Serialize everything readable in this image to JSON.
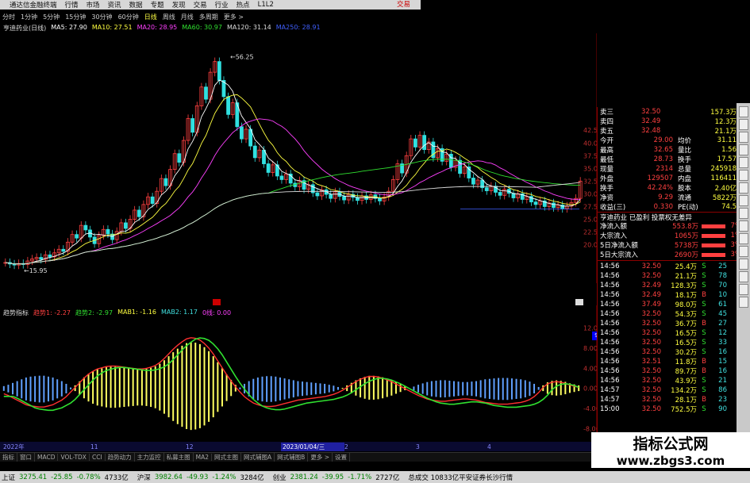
{
  "window": {
    "title": "通达信金融终端",
    "right_label": "交易"
  },
  "menu": [
    "行情",
    "市场",
    "资讯",
    "数据",
    "专题",
    "发现",
    "交易",
    "行业",
    "热点",
    "L1L2"
  ],
  "periods": [
    {
      "label": "分时"
    },
    {
      "label": "1分钟"
    },
    {
      "label": "5分钟"
    },
    {
      "label": "15分钟"
    },
    {
      "label": "30分钟"
    },
    {
      "label": "60分钟"
    },
    {
      "label": "日线",
      "active": true
    },
    {
      "label": "周线"
    },
    {
      "label": "月线"
    },
    {
      "label": "多周期"
    },
    {
      "label": "更多 >"
    }
  ],
  "ma_legend": {
    "name": "亨迪药业(日线)",
    "items": [
      {
        "label": "MA5: 27.90",
        "color": "#ffffff"
      },
      {
        "label": "MA10: 27.51",
        "color": "#ffff40"
      },
      {
        "label": "MA20: 28.95",
        "color": "#ff40ff"
      },
      {
        "label": "MA60: 30.97",
        "color": "#30e030"
      },
      {
        "label": "MA120: 31.14",
        "color": "#dddddd"
      },
      {
        "label": "MA250: 28.91",
        "color": "#4060ff"
      }
    ]
  },
  "main_annotations": {
    "high": "56.25",
    "low": "15.95"
  },
  "idx_legend": {
    "name": "趋势指标",
    "items": [
      {
        "label": "趋势1: -2.27",
        "color": "#ff4040"
      },
      {
        "label": "趋势2: -2.97",
        "color": "#30e030"
      },
      {
        "label": "MAB1: -1.16",
        "color": "#ffff40"
      },
      {
        "label": "MAB2: 1.17",
        "color": "#40e0e0"
      },
      {
        "label": "0线: 0.00",
        "color": "#ff40ff"
      }
    ]
  },
  "main_axis_labels": [
    "42.50",
    "40.00",
    "37.50",
    "35.00",
    "32.50",
    "30.00",
    "27.50",
    "25.00",
    "22.50",
    "20.00"
  ],
  "sub_axis_labels": [
    "12.00",
    "8.00",
    "4.00",
    "0.00",
    "-4.00",
    "-8.00"
  ],
  "sub_axis_marker": "9.18",
  "date_axis": {
    "left": "2022年",
    "marks": [
      "11",
      "12"
    ],
    "cursor": "2023/01/04/三",
    "right_marks": [
      "2",
      "3",
      "4"
    ]
  },
  "quote": {
    "asks": [
      {
        "label": "卖三",
        "price": "32.50",
        "vol": "157.3万"
      },
      {
        "label": "卖四",
        "price": "32.49",
        "vol": "12.3万"
      },
      {
        "label": "卖五",
        "price": "32.48",
        "vol": "21.1万"
      }
    ],
    "stats": [
      [
        "今开",
        "29.00",
        "均价",
        "31.11"
      ],
      [
        "最高",
        "32.65",
        "量比",
        "1.56"
      ],
      [
        "最低",
        "28.73",
        "换手",
        "17.57"
      ],
      [
        "现量",
        "2314",
        "总量",
        "245918"
      ],
      [
        "外盘",
        "129507",
        "内盘",
        "116411"
      ],
      [
        "换手",
        "42.24%",
        "股本",
        "2.40亿"
      ],
      [
        "净资",
        "9.29",
        "流通",
        "5822万"
      ],
      [
        "收益(三)",
        "0.330",
        "PE(动)",
        "74.5"
      ]
    ],
    "status_line": "亨迪药业 已盈利 投票权无差异",
    "flows": [
      {
        "label": "净流入额",
        "val": "553.8万",
        "pct": "7%"
      },
      {
        "label": "大宗流入",
        "val": "1065万",
        "pct": "1%"
      },
      {
        "label": "5日净流入额",
        "val": "5738万",
        "pct": "3%"
      },
      {
        "label": "5日大宗流入",
        "val": "2690万",
        "pct": "3%"
      }
    ],
    "trades": [
      [
        "14:56",
        "32.50",
        "25.4万",
        "S",
        "25"
      ],
      [
        "14:56",
        "32.50",
        "21.1万",
        "S",
        "78"
      ],
      [
        "14:56",
        "32.49",
        "128.3万",
        "S",
        "70"
      ],
      [
        "14:56",
        "32.49",
        "18.1万",
        "B",
        "10"
      ],
      [
        "14:56",
        "37.49",
        "98.0万",
        "S",
        "61"
      ],
      [
        "14:56",
        "32.50",
        "54.3万",
        "S",
        "45"
      ],
      [
        "14:56",
        "32.50",
        "36.7万",
        "B",
        "27"
      ],
      [
        "14:56",
        "32.50",
        "16.5万",
        "S",
        "12"
      ],
      [
        "14:56",
        "32.50",
        "16.5万",
        "S",
        "33"
      ],
      [
        "14:56",
        "32.50",
        "30.2万",
        "S",
        "16"
      ],
      [
        "14:56",
        "32.51",
        "11.8万",
        "B",
        "15"
      ],
      [
        "14:56",
        "32.50",
        "89.7万",
        "B",
        "16"
      ],
      [
        "14:56",
        "32.50",
        "43.9万",
        "S",
        "21"
      ],
      [
        "14:57",
        "32.50",
        "134.2万",
        "S",
        "86"
      ],
      [
        "14:57",
        "32.50",
        "28.1万",
        "B",
        "23"
      ],
      [
        "15:00",
        "32.50",
        "752.5万",
        "S",
        "90"
      ]
    ]
  },
  "tabs": [
    "指标",
    "窗口",
    "MACD",
    "VOL-TDX",
    "CCI",
    "趋势动力",
    "主力监控",
    "私募主图",
    "MA2",
    "网式主图",
    "网式辅图A",
    "网式辅图B",
    "更多 >",
    "设置"
  ],
  "tabs_right": "模板",
  "status": [
    {
      "label": "上证",
      "val": "3275.41",
      "chg": "-25.85",
      "pct": "-0.78%",
      "amt": "4733亿"
    },
    {
      "label": "沪深",
      "val": "3982.64",
      "chg": "-49.93",
      "pct": "-1.24%",
      "amt": "3284亿"
    },
    {
      "label": "创业",
      "val": "2381.24",
      "chg": "-39.95",
      "pct": "-1.71%",
      "amt": "2727亿"
    }
  ],
  "status_tail": "总成交 10833亿平安证券长沙行情",
  "watermark": {
    "line1": "指标公式网",
    "line2": "www.zbgs3.com"
  },
  "colors": {
    "up": "#ff4040",
    "down": "#30e0e0",
    "ma5": "#ffffff",
    "ma10": "#ffff40",
    "ma20": "#ff40ff",
    "ma60": "#30e030",
    "ma120": "#dddddd",
    "ma250": "#4060ff"
  },
  "chart_data": [
    {
      "type": "candlestick",
      "title": "亨迪药业(日线)",
      "ylim": [
        14,
        60
      ],
      "high_label": "56.25",
      "low_label": "15.95",
      "close": [
        16.5,
        16.2,
        16.0,
        16.3,
        16.1,
        16.8,
        17.2,
        17.5,
        17.1,
        18.0,
        17.6,
        18.4,
        19.1,
        18.7,
        20.5,
        22.0,
        21.3,
        23.8,
        22.9,
        21.5,
        20.2,
        21.8,
        23.0,
        22.1,
        21.0,
        22.6,
        24.3,
        23.2,
        25.0,
        26.8,
        25.5,
        27.9,
        29.4,
        28.1,
        30.5,
        33.0,
        31.6,
        34.8,
        37.9,
        36.2,
        40.5,
        44.8,
        42.1,
        47.3,
        51.0,
        48.6,
        53.9,
        56.0,
        52.3,
        49.1,
        45.6,
        47.9,
        43.2,
        40.8,
        42.7,
        39.4,
        37.1,
        38.6,
        35.9,
        34.2,
        35.7,
        33.5,
        32.8,
        33.9,
        32.1,
        31.4,
        32.6,
        30.9,
        31.8,
        30.2,
        29.6,
        30.8,
        29.9,
        29.1,
        30.4,
        29.5,
        28.8,
        29.9,
        29.3,
        28.7,
        29.6,
        28.9,
        29.8,
        29.1,
        28.6,
        29.4,
        30.5,
        32.8,
        35.9,
        34.1,
        37.5,
        40.8,
        39.2,
        41.5,
        38.7,
        40.2,
        37.1,
        38.9,
        36.4,
        37.8,
        35.2,
        36.6,
        34.0,
        35.3,
        33.1,
        31.9,
        32.7,
        31.2,
        30.6,
        31.5,
        30.3,
        29.7,
        30.9,
        30.1,
        29.2,
        30.0,
        28.9,
        29.5,
        28.4,
        27.9,
        28.6,
        27.5,
        28.2,
        27.3,
        27.8,
        27.1,
        27.6,
        28.3,
        29.1,
        32.5
      ],
      "ma_last": {
        "MA5": 27.9,
        "MA10": 27.51,
        "MA20": 28.95,
        "MA60": 30.97,
        "MA120": 31.14,
        "MA250": 28.91
      }
    },
    {
      "type": "indicator",
      "title": "趋势指标",
      "ylim": [
        -10,
        14
      ],
      "bars": [
        -0.5,
        -0.8,
        -1.2,
        -1.6,
        -2.0,
        -2.4,
        -2.6,
        -2.7,
        -2.8,
        -2.8,
        -2.6,
        -2.4,
        -2.0,
        -1.6,
        -1.0,
        -0.2,
        0.6,
        1.4,
        2.2,
        2.9,
        3.4,
        3.8,
        4.0,
        4.2,
        4.3,
        4.3,
        4.2,
        4.1,
        4.0,
        3.9,
        3.8,
        3.8,
        3.9,
        4.1,
        4.4,
        4.9,
        5.6,
        6.4,
        7.2,
        7.9,
        8.5,
        9.0,
        9.2,
        9.1,
        8.8,
        8.2,
        7.4,
        6.4,
        5.2,
        4.0,
        2.8,
        1.7,
        0.7,
        -0.2,
        -1.0,
        -1.6,
        -2.1,
        -2.4,
        -2.6,
        -2.7,
        -2.7,
        -2.6,
        -2.4,
        -2.2,
        -2.0,
        -1.8,
        -1.6,
        -1.5,
        -1.4,
        -1.3,
        -1.2,
        -1.1,
        -1.0,
        -0.8,
        -0.6,
        -0.3,
        0.1,
        0.6,
        1.1,
        1.6,
        2.0,
        2.3,
        2.5,
        2.5,
        2.4,
        2.2,
        1.9,
        1.6,
        1.2,
        0.8,
        0.4,
        0.0,
        -0.4,
        -0.8,
        -1.1,
        -1.4,
        -1.6,
        -1.7,
        -1.8,
        -1.8,
        -1.7,
        -1.6,
        -1.5,
        -1.4,
        -1.4,
        -1.5,
        -1.6,
        -1.8,
        -2.0,
        -2.1,
        -2.2,
        -2.3,
        -2.3,
        -2.3,
        -2.2,
        -2.1,
        -2.0,
        -1.8,
        -1.5,
        -1.0,
        -0.3,
        0.6,
        1.2,
        1.5,
        1.6,
        1.5,
        1.3,
        1.0,
        0.8,
        0.6
      ],
      "ind1_last": -2.27,
      "ind2_last": -2.97,
      "mab1": -1.16,
      "mab2": 1.17,
      "zero": 0.0
    }
  ]
}
